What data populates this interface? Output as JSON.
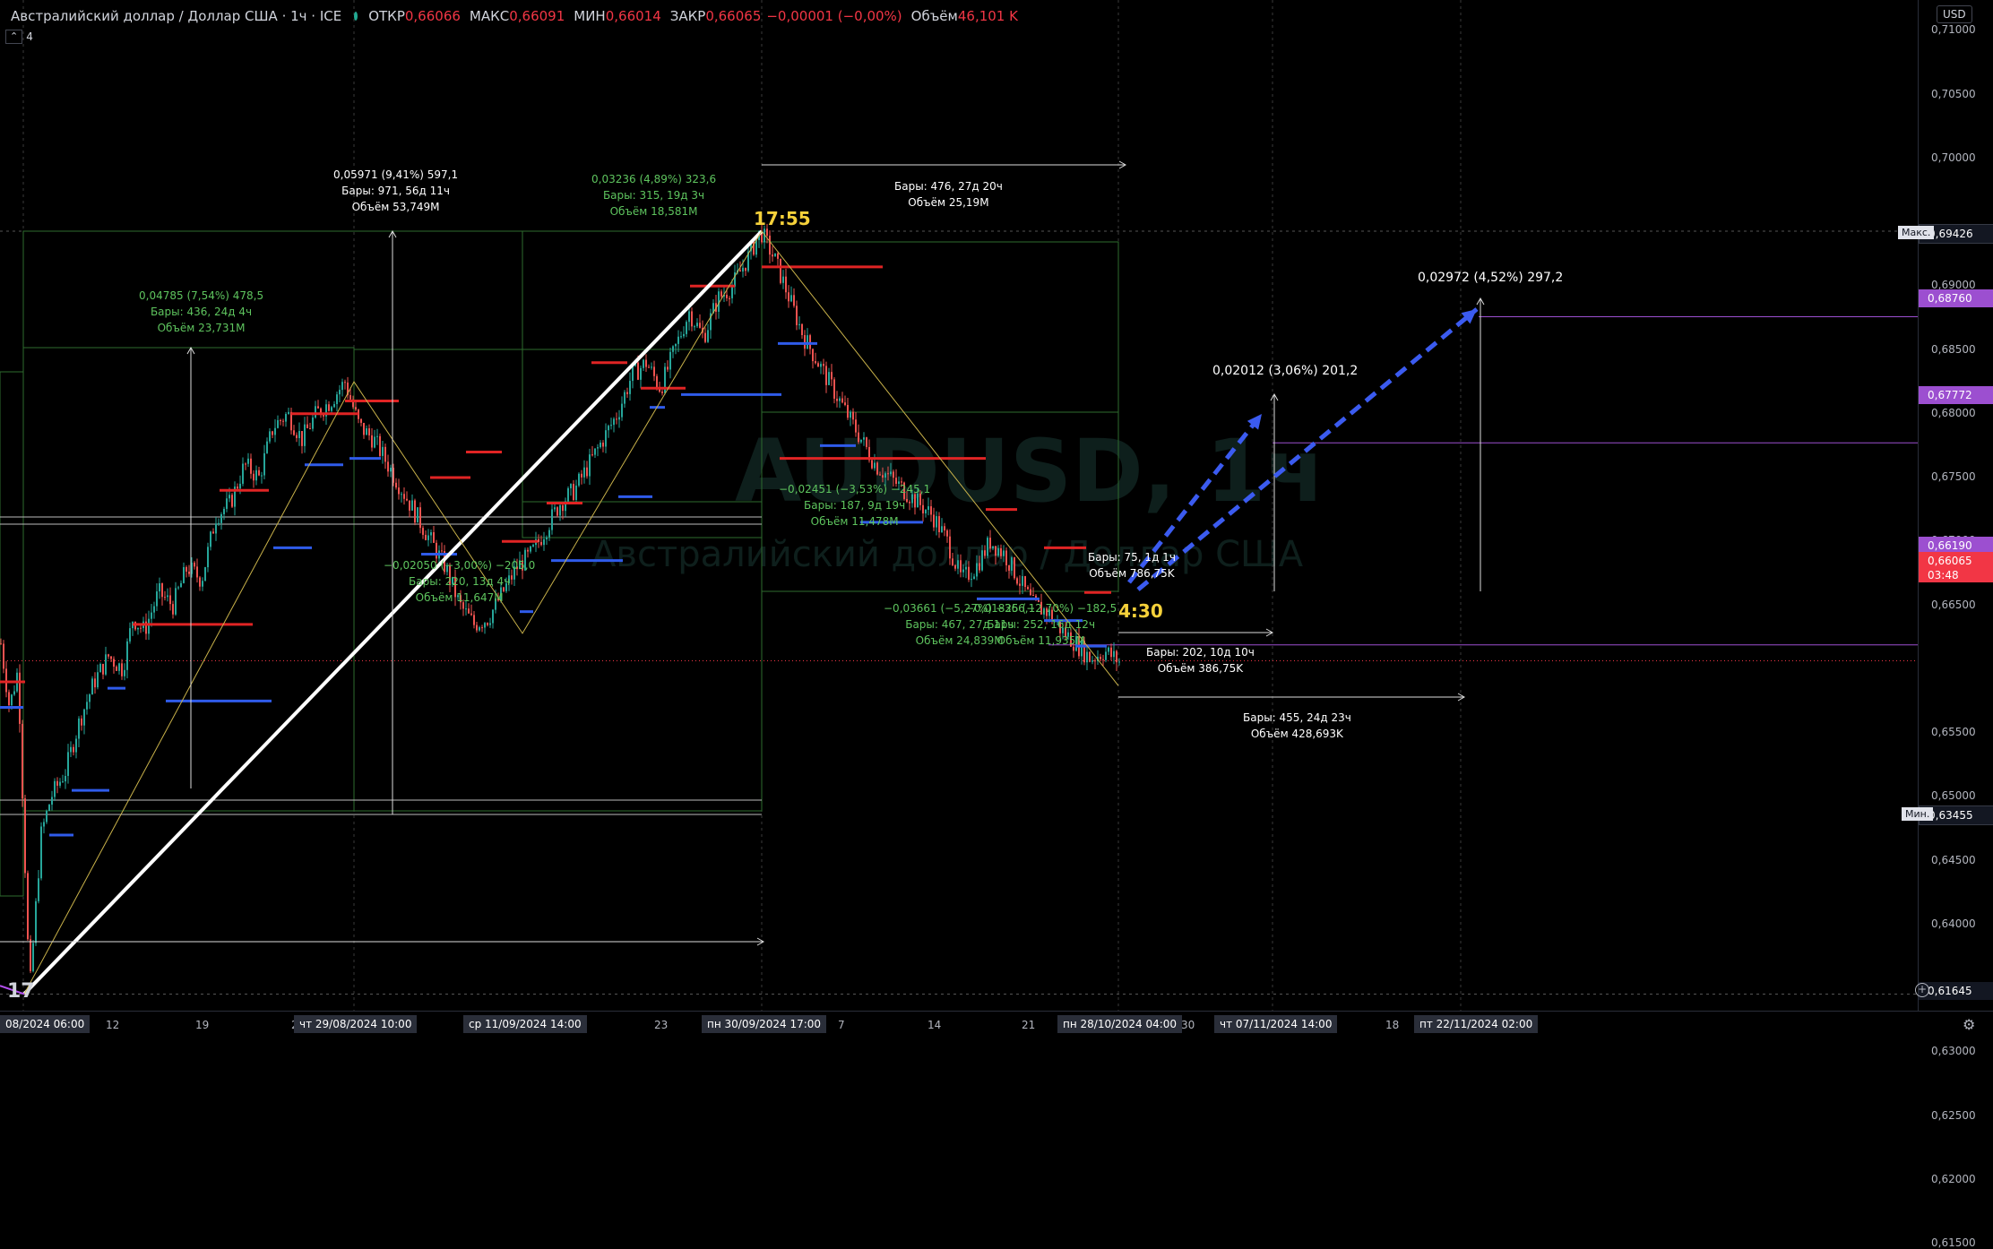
{
  "legend": {
    "title": "Австралийский доллар / Доллар США · 1ч · ICE",
    "open_label": "ОТКР",
    "open": "0,66066",
    "high_label": "МАКС",
    "high": "0,66091",
    "low_label": "МИН",
    "low": "0,66014",
    "close_label": "ЗАКР",
    "close": "0,66065",
    "change": "−0,00001 (−0,00%)",
    "volume_label": "Объём",
    "volume": "46,101 K",
    "indicator_count": "4"
  },
  "watermark": {
    "symbol": "AUDUSD, 1ч",
    "name": "Австралийский доллар / Доллар США"
  },
  "price_axis": {
    "currency": "USD",
    "ticks": [
      "0,71000",
      "0,70500",
      "0,70000",
      "0,69000",
      "0,68500",
      "0,68000",
      "0,67500",
      "0,67000",
      "0,66500",
      "0,65500",
      "0,65000",
      "0,64500",
      "0,64000",
      "0,63000",
      "0,62500",
      "0,62000",
      "0,61500"
    ],
    "max_label": "Макс.",
    "max_value": "0,69426",
    "min_label": "Мин.",
    "min_value": "0,63455",
    "target1": "0,68760",
    "target2": "0,67772",
    "level": "0,66190",
    "last_price": "0,66065",
    "countdown": "03:48",
    "alert_price": "0,61645"
  },
  "time_axis": {
    "ticks": [
      "12",
      "19",
      "2",
      "23",
      "7",
      "14",
      "21",
      "30",
      "18"
    ],
    "badges": [
      "08/2024   06:00",
      "чт 29/08/2024   10:00",
      "ср 11/09/2024   14:00",
      "пн 30/09/2024   17:00",
      "пн 28/10/2024   04:00",
      "чт 07/11/2024   14:00",
      "пт 22/11/2024   02:00"
    ]
  },
  "annotations": {
    "a1_l1": "0,05971 (9,41%) 597,1",
    "a1_l2": "Бары: 971, 56д 11ч",
    "a1_l3": "Объём 53,749M",
    "a2_l1": "0,03236 (4,89%) 323,6",
    "a2_l2": "Бары: 315, 19д 3ч",
    "a2_l3": "Объём 18,581M",
    "a3_l1": "Бары: 476, 27д 20ч",
    "a3_l2": "Объём 25,19M",
    "a4_l1": "0,04785 (7,54%) 478,5",
    "a4_l2": "Бары: 436, 24д 4ч",
    "a4_l3": "Объём 23,731M",
    "a5_l1": "0,02972 (4,52%) 297,2",
    "a6_l1": "0,02012 (3,06%) 201,2",
    "a7_l1": "−0,02451 (−3,53%) −245,1",
    "a7_l2": "Бары: 187, 9д 19ч",
    "a7_l3": "Объём 11,478M",
    "a8_l1": "−0,02050 (−3,00%) −205,0",
    "a8_l2": "Бары: 220, 13д 4ч",
    "a8_l3": "Объём 11,647M",
    "a9_l1": "Бары: 75, 1д 1ч",
    "a9_l2": "Объём 786,75K",
    "a10_l1": "−0,03661 (−5,27%) −366,1",
    "a10_l2": "Бары: 467, 27д 11ч",
    "a10_l3": "Объём 24,839M",
    "a11_l1": "−0,01825 (−2,70%) −182,5",
    "a11_l2": "Бары: 252, 16д 12ч",
    "a11_l3": "Объём 11,935M",
    "a12_l1": "Бары: 202, 10д 10ч",
    "a12_l2": "Объём 386,75K",
    "a13_l1": "Бары: 455, 24д 23ч",
    "a13_l2": "Объём 428,693K",
    "time_high": "17:55",
    "time_low": "4:30"
  },
  "chart_data": {
    "type": "candlestick",
    "title": "Австралийский доллар / Доллар США · 1ч · ICE",
    "ylim": [
      0.61,
      0.715
    ],
    "price_path": [
      [
        0.0,
        0.662
      ],
      [
        0.6,
        0.657
      ],
      [
        1.2,
        0.66
      ],
      [
        2.0,
        0.6346
      ],
      [
        2.8,
        0.647
      ],
      [
        3.5,
        0.65
      ],
      [
        4.5,
        0.652
      ],
      [
        5.5,
        0.656
      ],
      [
        6.5,
        0.659
      ],
      [
        7.5,
        0.661
      ],
      [
        8.5,
        0.66
      ],
      [
        9.2,
        0.664
      ],
      [
        10,
        0.663
      ],
      [
        11,
        0.666
      ],
      [
        12,
        0.665
      ],
      [
        13,
        0.668
      ],
      [
        14,
        0.667
      ],
      [
        15,
        0.672
      ],
      [
        16,
        0.673
      ],
      [
        17,
        0.676
      ],
      [
        18,
        0.675
      ],
      [
        19,
        0.679
      ],
      [
        20,
        0.68
      ],
      [
        21,
        0.678
      ],
      [
        22,
        0.68
      ],
      [
        23,
        0.681
      ],
      [
        24,
        0.6825
      ],
      [
        25,
        0.679
      ],
      [
        26,
        0.678
      ],
      [
        27,
        0.676
      ],
      [
        28,
        0.674
      ],
      [
        29,
        0.672
      ],
      [
        30,
        0.67
      ],
      [
        31,
        0.668
      ],
      [
        32,
        0.665
      ],
      [
        33,
        0.6635
      ],
      [
        34,
        0.664
      ],
      [
        35,
        0.666
      ],
      [
        36,
        0.668
      ],
      [
        37,
        0.669
      ],
      [
        38,
        0.671
      ],
      [
        39,
        0.673
      ],
      [
        40,
        0.674
      ],
      [
        41,
        0.676
      ],
      [
        42,
        0.678
      ],
      [
        43,
        0.68
      ],
      [
        44,
        0.683
      ],
      [
        45,
        0.684
      ],
      [
        46,
        0.682
      ],
      [
        47,
        0.685
      ],
      [
        48,
        0.688
      ],
      [
        49,
        0.686
      ],
      [
        50,
        0.689
      ],
      [
        51,
        0.69
      ],
      [
        52,
        0.692
      ],
      [
        53,
        0.6943
      ],
      [
        54,
        0.692
      ],
      [
        55,
        0.689
      ],
      [
        56,
        0.686
      ],
      [
        57,
        0.684
      ],
      [
        58,
        0.682
      ],
      [
        59,
        0.68
      ],
      [
        60,
        0.678
      ],
      [
        61,
        0.676
      ],
      [
        62,
        0.675
      ],
      [
        63,
        0.674
      ],
      [
        64,
        0.673
      ],
      [
        65,
        0.672
      ],
      [
        66,
        0.67
      ],
      [
        67,
        0.667
      ],
      [
        68,
        0.668
      ],
      [
        69,
        0.67
      ],
      [
        70,
        0.669
      ],
      [
        71,
        0.667
      ],
      [
        72,
        0.665
      ],
      [
        73,
        0.6645
      ],
      [
        74,
        0.663
      ],
      [
        75,
        0.662
      ],
      [
        76,
        0.6608
      ],
      [
        77,
        0.6614
      ],
      [
        78,
        0.6606
      ]
    ]
  }
}
